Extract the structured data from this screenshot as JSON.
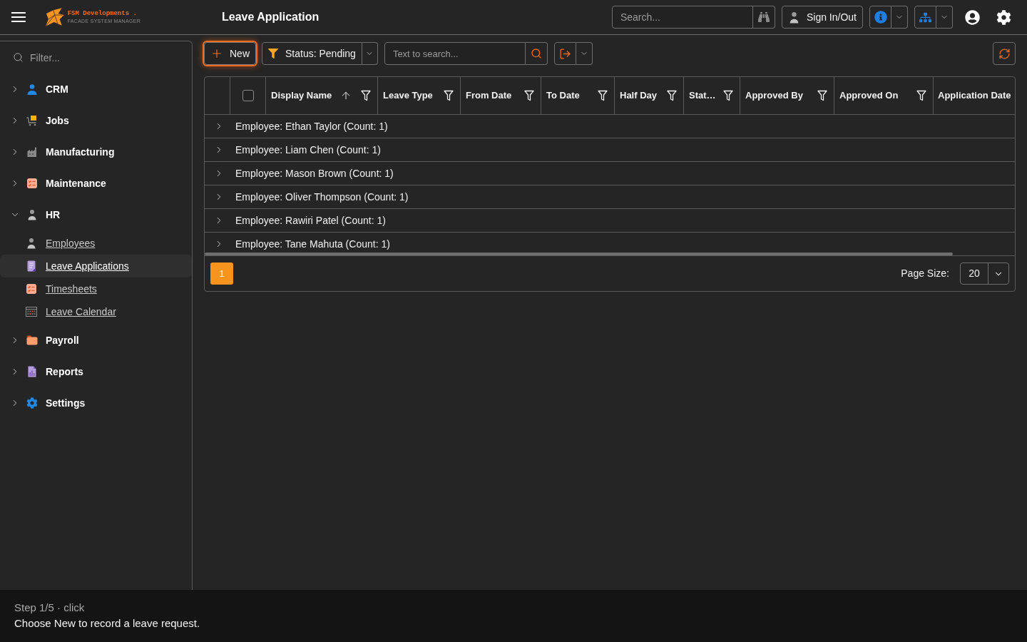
{
  "header": {
    "logo": {
      "name": "FSM Developments .",
      "tagline": "FACADE SYSTEM MANAGER"
    },
    "title": "Leave Application",
    "search": {
      "placeholder": "Search..."
    },
    "sign_in_button": "Sign In/Out"
  },
  "sidebar": {
    "filter": {
      "placeholder": "Filter..."
    },
    "items": [
      {
        "label": "CRM",
        "expanded": false
      },
      {
        "label": "Jobs",
        "expanded": false
      },
      {
        "label": "Manufacturing",
        "expanded": false
      },
      {
        "label": "Maintenance",
        "expanded": false
      },
      {
        "label": "HR",
        "expanded": true,
        "children": [
          {
            "label": "Employees",
            "selected": false
          },
          {
            "label": "Leave Applications",
            "selected": true
          },
          {
            "label": "Timesheets",
            "selected": false
          },
          {
            "label": "Leave Calendar",
            "selected": false
          }
        ]
      },
      {
        "label": "Payroll",
        "expanded": false
      },
      {
        "label": "Reports",
        "expanded": false
      },
      {
        "label": "Settings",
        "expanded": false
      }
    ]
  },
  "toolbar": {
    "new_button": {
      "label": "New",
      "focused": true
    },
    "status_filter": "Status: Pending",
    "search": {
      "placeholder": "Text to search..."
    }
  },
  "grid": {
    "select_all": {
      "checked": false
    },
    "columns": [
      {
        "label": "Display Name",
        "sorted": true,
        "filter": true
      },
      {
        "label": "Leave Type",
        "sorted": false,
        "filter": true
      },
      {
        "label": "From Date",
        "sorted": false,
        "filter": true
      },
      {
        "label": "To Date",
        "sorted": false,
        "filter": true
      },
      {
        "label": "Half Day",
        "sorted": false,
        "filter": true
      },
      {
        "label": "Stat…",
        "sorted": false,
        "filter": true
      },
      {
        "label": "Approved By",
        "sorted": false,
        "filter": true
      },
      {
        "label": "Approved On",
        "sorted": false,
        "filter": true
      },
      {
        "label": "Application Date",
        "sorted": false,
        "filter": false
      }
    ],
    "groups": [
      {
        "label": "Employee: Ethan Taylor (Count: 1)",
        "expanded": false
      },
      {
        "label": "Employee: Liam Chen (Count: 1)",
        "expanded": false
      },
      {
        "label": "Employee: Mason Brown (Count: 1)",
        "expanded": false
      },
      {
        "label": "Employee: Oliver Thompson (Count: 1)",
        "expanded": false
      },
      {
        "label": "Employee: Rawiri Patel (Count: 1)",
        "expanded": false
      },
      {
        "label": "Employee: Tane Mahuta (Count: 1)",
        "expanded": false
      }
    ],
    "pager": {
      "pages": [
        {
          "label": "1",
          "selected": true
        }
      ],
      "page_size_label": "Page Size:",
      "page_size": "20"
    }
  },
  "tour": {
    "step": "Step 1/5 · click",
    "message": "Choose New to record a leave request."
  }
}
